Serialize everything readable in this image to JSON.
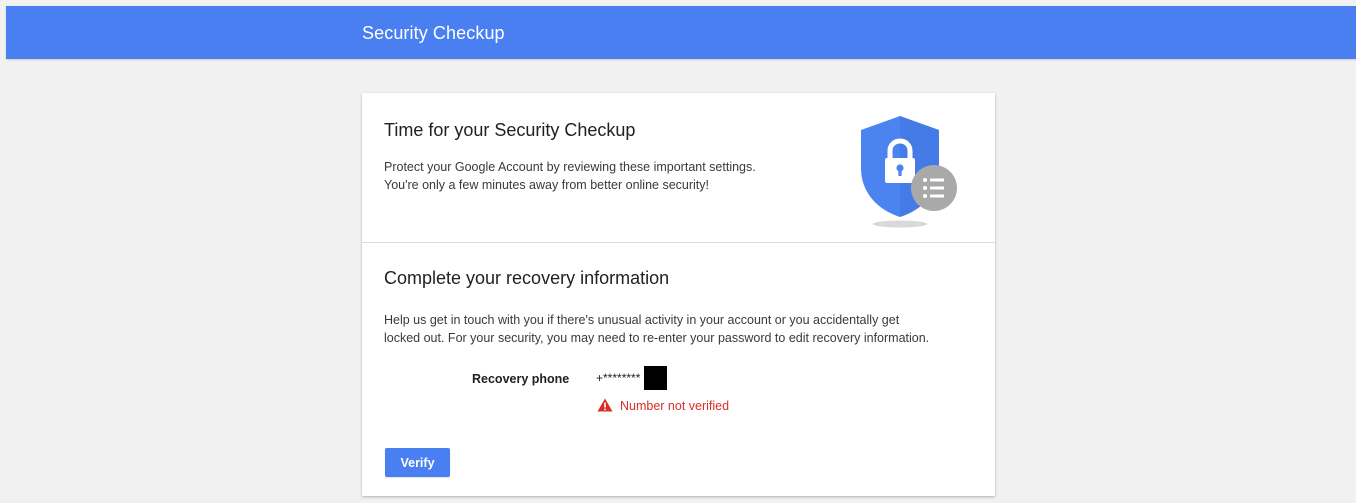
{
  "header": {
    "title": "Security Checkup"
  },
  "intro": {
    "title": "Time for your Security Checkup",
    "desc_line1": "Protect your Google Account by reviewing these important settings.",
    "desc_line2": "You're only a few minutes away from better online security!",
    "illustration": "shield-lock-checklist-icon"
  },
  "recovery": {
    "title": "Complete your recovery information",
    "desc_line1": "Help us get in touch with you if there's unusual activity in your account or you accidentally get",
    "desc_line2": "locked out. For your security, you may need to re-enter your password to edit recovery information.",
    "phone_label": "Recovery phone",
    "phone_value": "+********",
    "warning_icon": "warning-triangle-icon",
    "warning_text": "Number not verified",
    "verify_label": "Verify"
  },
  "colors": {
    "brand_blue": "#4a7ff2",
    "shield_blue": "#4b84f1",
    "warning_red": "#d93025",
    "page_bg": "#f1f1f1"
  }
}
